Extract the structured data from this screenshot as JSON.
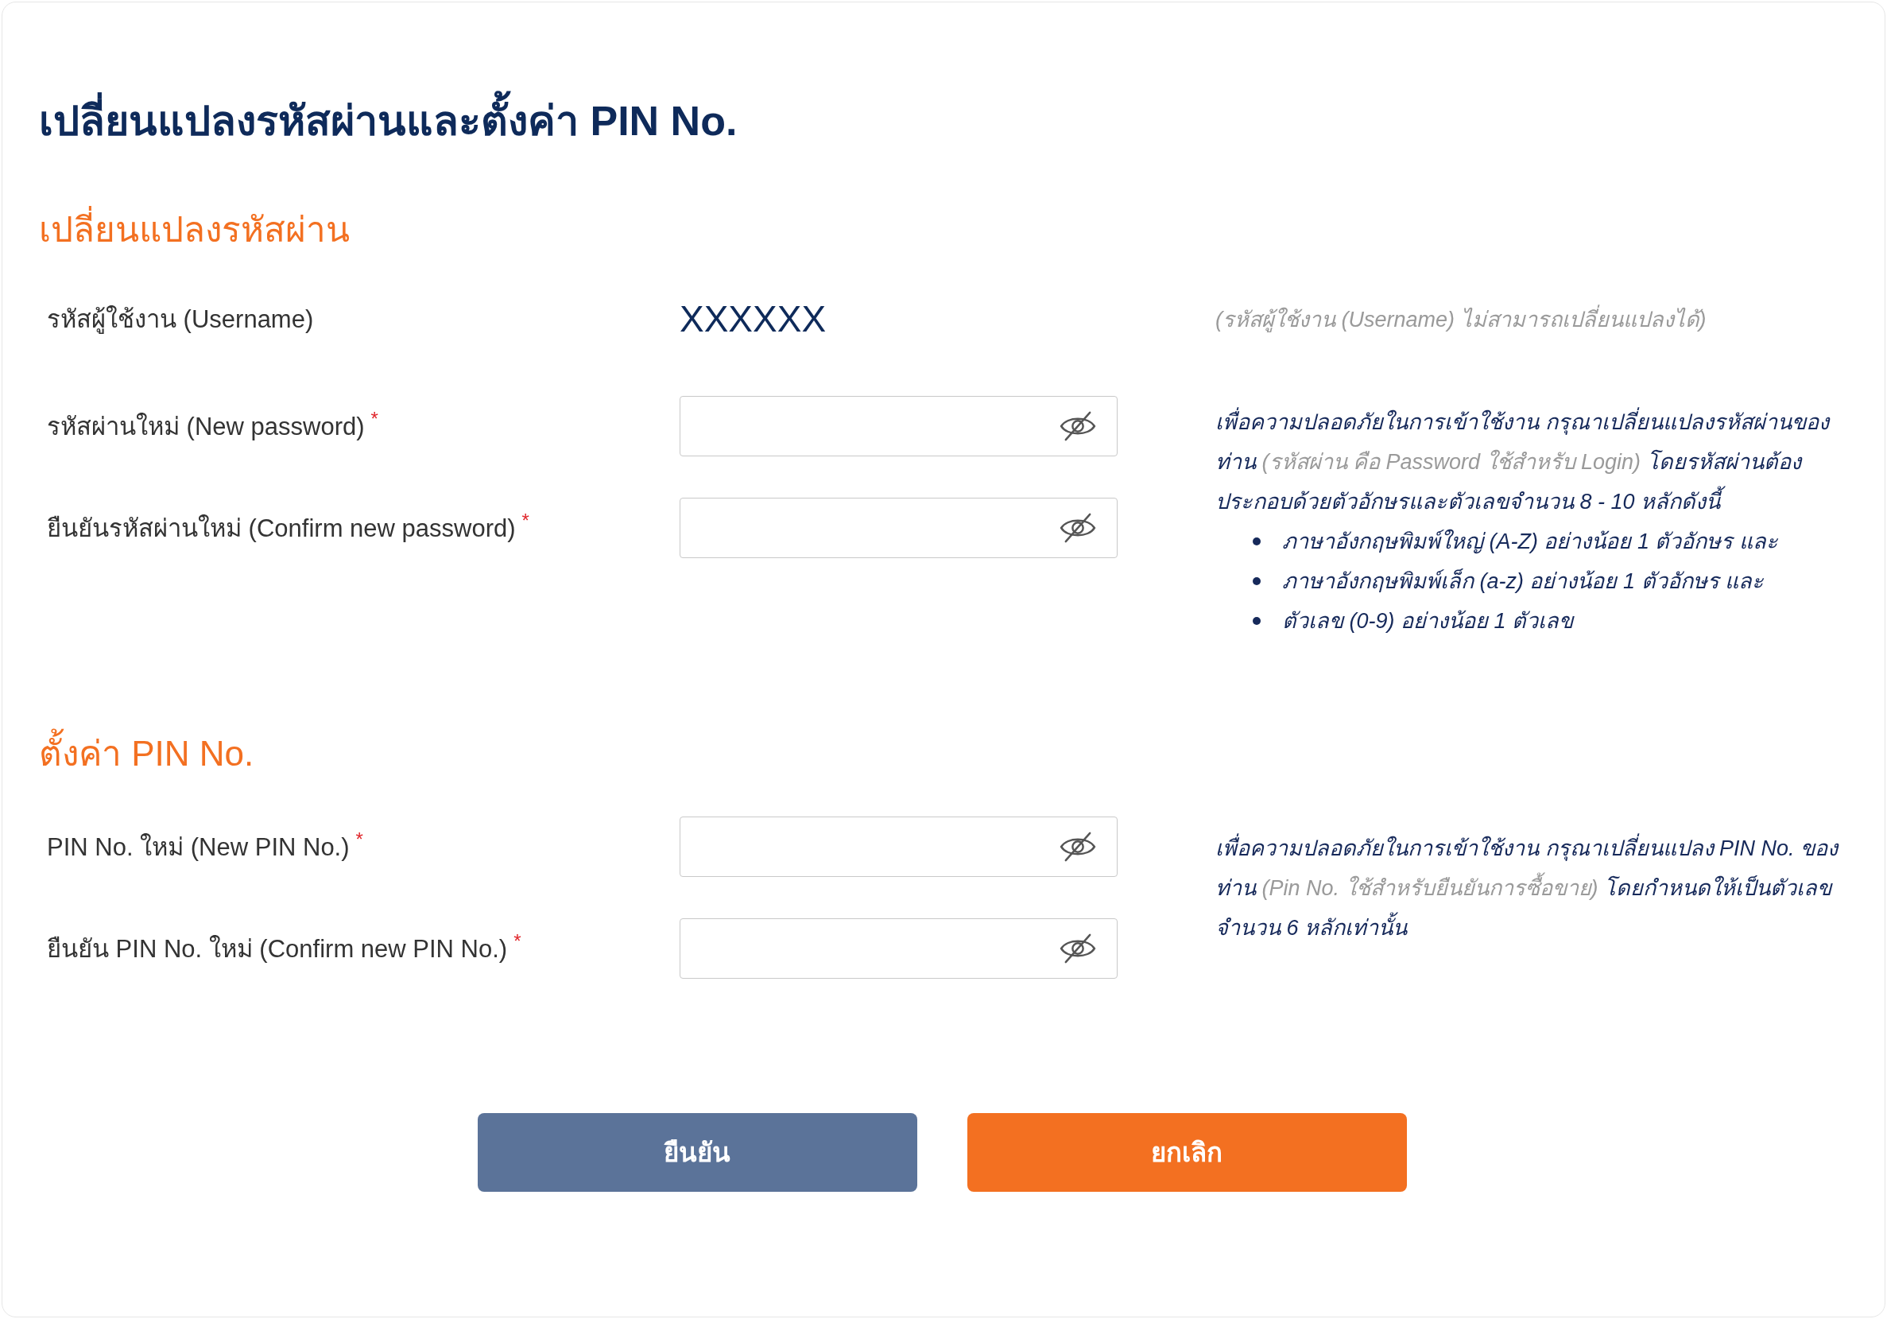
{
  "title": "เปลี่ยนแปลงรหัสผ่านและตั้งค่า PIN No.",
  "password_section": {
    "heading": "เปลี่ยนแปลงรหัสผ่าน",
    "username": {
      "label": "รหัสผู้ใช้งาน (Username)",
      "value": "XXXXXX",
      "note": "(รหัสผู้ใช้งาน (Username) ไม่สามารถเปลี่ยนแปลงได้)"
    },
    "fields": [
      {
        "label": "รหัสผ่านใหม่ (New password)",
        "required_mark": "*",
        "revealed": false
      },
      {
        "label": "ยืนยันรหัสผ่านใหม่ (Confirm new password)",
        "required_mark": "*",
        "revealed": false
      }
    ],
    "hint": {
      "segments": [
        {
          "text": "เพื่อความปลอดภัยในการเข้าใช้งาน กรุณาเปลี่ยนแปลงรหัสผ่านของท่าน ",
          "muted": false
        },
        {
          "text": "(รหัสผ่าน คือ Password ใช้สำหรับ Login)",
          "muted": true
        },
        {
          "text": " โดยรหัสผ่านต้องประกอบด้วยตัวอักษรและตัวเลขจำนวน 8 - 10 หลักดังนี้",
          "muted": false
        }
      ],
      "bullets": [
        "ภาษาอังกฤษพิมพ์ใหญ่ (A-Z) อย่างน้อย 1 ตัวอักษร และ",
        "ภาษาอังกฤษพิมพ์เล็ก (a-z) อย่างน้อย 1 ตัวอักษร และ",
        "ตัวเลข (0-9) อย่างน้อย 1 ตัวเลข"
      ]
    }
  },
  "pin_section": {
    "heading": "ตั้งค่า PIN No.",
    "fields": [
      {
        "label": "PIN No. ใหม่ (New PIN No.)",
        "required_mark": "*",
        "revealed": false
      },
      {
        "label": "ยืนยัน PIN No. ใหม่ (Confirm new PIN No.)",
        "required_mark": "*",
        "revealed": false
      }
    ],
    "hint": {
      "segments": [
        {
          "text": "เพื่อความปลอดภัยในการเข้าใช้งาน กรุณาเปลี่ยนแปลง PIN No. ของท่าน ",
          "muted": false
        },
        {
          "text": "(Pin No. ใช้สำหรับยืนยันการซื้อขาย)",
          "muted": true
        },
        {
          "text": " โดยกำหนดให้เป็นตัวเลขจำนวน 6 หลักเท่านั้น",
          "muted": false
        }
      ]
    }
  },
  "buttons": [
    {
      "label": "ยืนยัน",
      "kind": "confirm"
    },
    {
      "label": "ยกเลิก",
      "kind": "cancel"
    }
  ]
}
